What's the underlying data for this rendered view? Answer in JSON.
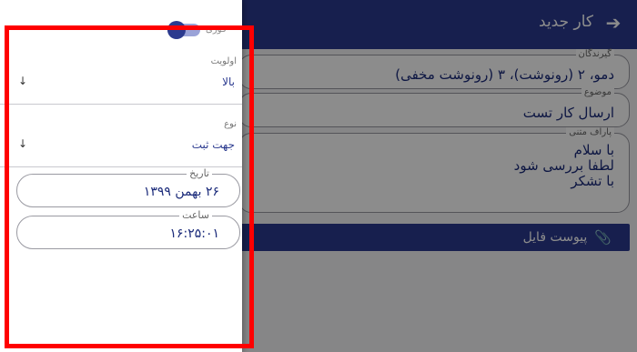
{
  "main": {
    "title": "کار جدید",
    "back_icon": "arrow-forward-icon",
    "fields": {
      "recipients": {
        "label": "گیرندگان",
        "value": "دمو، ۲ (رونوشت)، ۳ (رونوشت مخفی)"
      },
      "subject": {
        "label": "موضوع",
        "value": "ارسال کار تست"
      },
      "body": {
        "label": "پاراف متنی",
        "value": "با سلام\nلطفا بررسی شود\nبا تشکر"
      }
    },
    "attach_label": "پیوست فایل",
    "attach_icon": "paperclip-icon"
  },
  "drawer": {
    "toggle_label": "فوری",
    "priority": {
      "label": "اولویت",
      "value": "بالا",
      "arrow": "↓"
    },
    "type": {
      "label": "نوع",
      "value": "جهت ثبت",
      "arrow": "↓"
    },
    "date": {
      "label": "تاریخ",
      "value": "۲۶ بهمن ۱۳۹۹"
    },
    "time": {
      "label": "ساعت",
      "value": "۱۶:۲۵:۰۱"
    }
  },
  "colors": {
    "primary": "#2b3a8f",
    "highlight": "#ff0000"
  }
}
